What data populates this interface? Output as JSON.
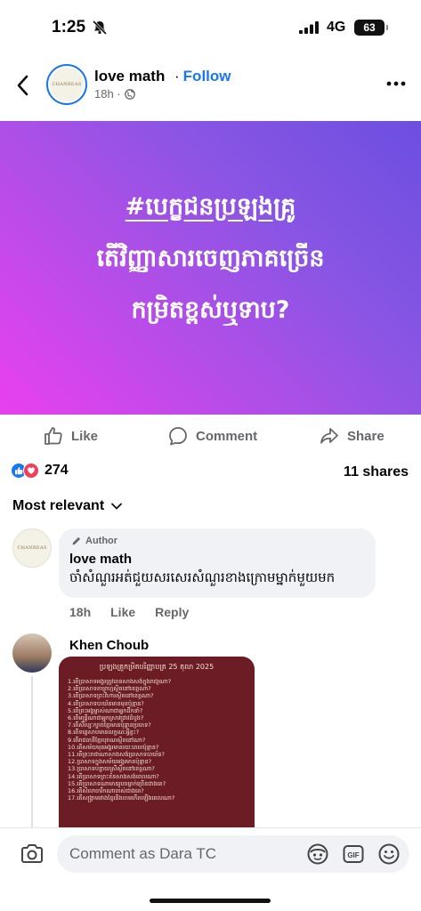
{
  "status_bar": {
    "time": "1:25",
    "network": "4G",
    "battery": "63"
  },
  "header": {
    "page_name": "love math",
    "separator": "·",
    "follow_label": "Follow",
    "time_ago": "18h ·",
    "avatar_logo_text": "CHANREAS"
  },
  "banner": {
    "line1": "#បេក្ខជនប្រឡងគ្រូ",
    "line2": "តើវិញ្ញាសារចេញភាគច្រើន",
    "line3": "កម្រិតខ្ពស់ឬទាប?"
  },
  "actions": {
    "like": "Like",
    "comment": "Comment",
    "share": "Share"
  },
  "stats": {
    "reaction_count": "274",
    "shares": "11 shares"
  },
  "sort_label": "Most relevant",
  "comments": [
    {
      "badge": "Author",
      "name": "love math",
      "text": "ចាំសំណួរអត់ជួយសរសេរសំណួរខាងក្រោមម្នាក់មួយមក",
      "time": "18h",
      "like": "Like",
      "reply": "Reply"
    },
    {
      "name": "Khen Choub",
      "image_title": "ប្រឡងគ្រូកម្រិតបរិញ្ញាបត្រ 25 តុលា 2025",
      "image_lines": [
        "1.តើប្រាសាទអង្គរត្រូវបានសាងសង់ក្នុងរាជ្យណា?",
        "2.តើប្រាសាទតាព្រហ្មស្ថិតនៅខេត្តណា?",
        "3.តើប្រាសាទព្រះវិហារស្ថិតនៅខេត្តណា?",
        "4.តើប្រាសាទបាយ័នមានមុខប៉ុន្មាន?",
        "5.តើព្រះអង្គម្ចាស់ណាជាអ្នកដឹកនាំ?",
        "6.តើមន្ត្រីណាជាអ្នកស្រាវជ្រាវដំបូង?",
        "7.តើសិល្បៈក្បាច់ខ្មែរមានប៉ុន្មានប្រភេទ?",
        "8.តើទន្លេសាបមានលក្ខណៈអ្វីខ្លះ?",
        "9.តើរាជធានីខ្មែរបុរាណស្ថិតនៅណា?",
        "10.តើសម័យមុនអង្គរមានរយៈពេលប៉ុន្មាន?",
        "11.តើព្រះរាជាណាសាងសង់ប្រាសាទបាយ័ន?",
        "12.ប្រាសាទក្នុងសម័យអង្គរមានប៉ុន្មាន?",
        "13.ប្រាសាទបន្ទាយស្រីស្ថិតនៅខេត្តណា?",
        "14.តើប្រាសាទព្រះខ័នសាងសង់ពេលណា?",
        "15.តើប្រាសាទណាមានរូបចម្លាក់ច្រើនជាងគេ?",
        "16.តើសិលាចារឹកណាចាស់ជាងគេ?",
        "17.តើសង្គ្រាមរវាងខ្មែរនិងចាមកើតឡើងពេលណា?"
      ]
    }
  ],
  "composer": {
    "placeholder": "Comment as Dara TC"
  }
}
